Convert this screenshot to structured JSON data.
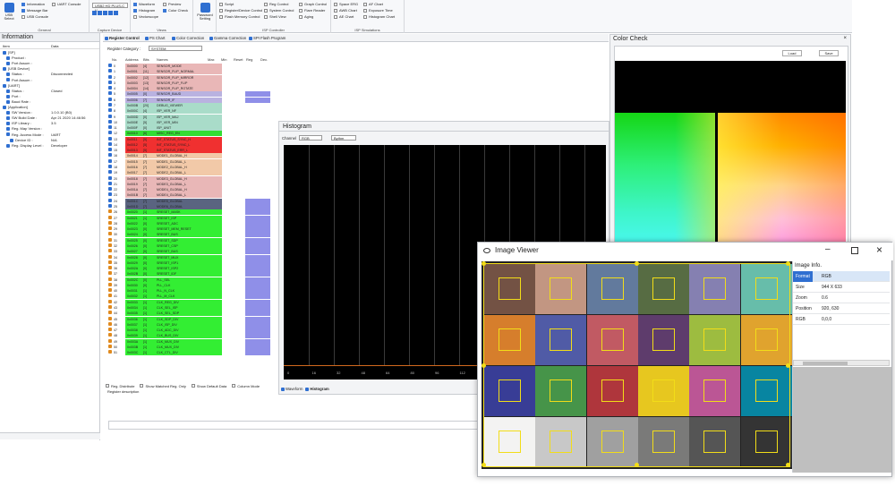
{
  "ribbon": {
    "usb_select_label": "USB Select",
    "general_checks": [
      "Information",
      "Message Bar",
      "USB Console"
    ],
    "general_checks2": [
      "UART Console"
    ],
    "general_caption": "General",
    "capture_combo": "USB2 HD PLUS-C V...",
    "capture_caption": "Capture Device",
    "view_checks": [
      "Waveform",
      "Histogram",
      "Vectorscope"
    ],
    "view_checks2": [
      "Preview",
      "Color Check"
    ],
    "view_caption": "Views",
    "password_label": "Password Setting",
    "isp_checks": [
      "Script",
      "Register/Device Control",
      "Flash Memory Control"
    ],
    "isp_checks2": [
      "Reg Control",
      "System Control",
      "Shell View"
    ],
    "isp_checks3": [
      "Graph Control",
      "Flare Reader",
      "Aging"
    ],
    "isp_caption": "ISP Controller",
    "spec_checks": [
      "Space ERG",
      "AWB Chart",
      "AE Chart"
    ],
    "spec_checks2": [
      "AF Chart",
      "Exposure Time",
      "Histogram Chart"
    ],
    "spec_caption": "ISP Simulations"
  },
  "info_panel": {
    "title": "Information",
    "col_item": "Item",
    "col_data": "Data",
    "rows": [
      {
        "k": "[SP]",
        "v": "",
        "lvl": 0,
        "icon": true
      },
      {
        "k": "Product :",
        "v": "",
        "lvl": 1,
        "icon": true
      },
      {
        "k": "Port Assum :",
        "v": "",
        "lvl": 1,
        "icon": true
      },
      {
        "k": "[USB Device]",
        "v": "",
        "lvl": 0,
        "icon": true
      },
      {
        "k": "Status :",
        "v": "Disconnected",
        "lvl": 1,
        "icon": true
      },
      {
        "k": "Port Assum :",
        "v": "",
        "lvl": 1,
        "icon": true
      },
      {
        "k": "[UART]",
        "v": "",
        "lvl": 0,
        "icon": true
      },
      {
        "k": "Status :",
        "v": "Closed",
        "lvl": 1,
        "icon": true
      },
      {
        "k": "Port :",
        "v": "",
        "lvl": 1,
        "icon": true
      },
      {
        "k": "Baud Rate :",
        "v": "",
        "lvl": 1,
        "icon": true
      },
      {
        "k": "[Application]",
        "v": "",
        "lvl": 0,
        "icon": true
      },
      {
        "k": "SW Version :",
        "v": "1.0.0.10 (B0)",
        "lvl": 1,
        "icon": true
      },
      {
        "k": "SW Build Date :",
        "v": "Apr 21 2020 14:46:56",
        "lvl": 1,
        "icon": true
      },
      {
        "k": "ISP Library :",
        "v": "3.5",
        "lvl": 1,
        "icon": true
      },
      {
        "k": "Reg. Map Version :",
        "v": "",
        "lvl": 1,
        "icon": true
      },
      {
        "k": "Reg. Access Mode :",
        "v": "UART",
        "lvl": 1,
        "icon": true
      },
      {
        "k": "Device ID :",
        "v": "N/A",
        "lvl": 2,
        "icon": true
      },
      {
        "k": "Reg. Display Level :",
        "v": "Developer",
        "lvl": 1,
        "icon": true
      }
    ]
  },
  "tabs": [
    "Register Control",
    "PS Chart",
    "Color Correction",
    "Gamma Correction",
    "SPI Flash Program"
  ],
  "register": {
    "category_label": "Register Category :",
    "category_value": "SYSTEM",
    "headers": [
      "No.",
      "Address",
      "Bits",
      "Names",
      "Max",
      "Min",
      "Reset",
      "Reg",
      "Dec."
    ],
    "rows": [
      {
        "no": "0",
        "addr": "0x0000",
        "bits": "[4]",
        "name": "SENSOR_MODE",
        "c": "#e9b7b7"
      },
      {
        "no": "1",
        "addr": "0x0001",
        "bits": "[11]",
        "name": "SENSOR_FLIP_NORMAL",
        "c": "#e9b7b7"
      },
      {
        "no": "2",
        "addr": "0x0002",
        "bits": "[12]",
        "name": "SENSOR_FLIP_MIRROR",
        "c": "#e9b7b7"
      },
      {
        "no": "3",
        "addr": "0x0003",
        "bits": "[13]",
        "name": "SENSOR_FLIP_FLIP",
        "c": "#e9b7b7"
      },
      {
        "no": "4",
        "addr": "0x0004",
        "bits": "[14]",
        "name": "SENSOR_FLIP_ROTATE",
        "c": "#e9b7b7"
      },
      {
        "no": "5",
        "addr": "0x0005",
        "bits": "[0]",
        "name": "SENSOR_BAUD",
        "c": "#b9b2e0"
      },
      {
        "no": "6",
        "addr": "0x0006",
        "bits": "[7]",
        "name": "SENSOR_IF",
        "c": "#b9b2e0"
      },
      {
        "no": "7",
        "addr": "0x000B",
        "bits": "[20]",
        "name": "DEBUG_VIEWER",
        "c": "#a9dcc9"
      },
      {
        "no": "8",
        "addr": "0x000C",
        "bits": "[4]",
        "name": "ISP_VER_NF",
        "c": "#a9dcc9"
      },
      {
        "no": "9",
        "addr": "0x000D",
        "bits": "[0]",
        "name": "ISP_VER_MAJ",
        "c": "#a9dcc9"
      },
      {
        "no": "10",
        "addr": "0x000E",
        "bits": "[5]",
        "name": "ISP_VER_MIN",
        "c": "#a9dcc9"
      },
      {
        "no": "11",
        "addr": "0x000F",
        "bits": "[0]",
        "name": "ISP_UNIT",
        "c": "#a9dcc9"
      },
      {
        "no": "12",
        "addr": "0x0010",
        "bits": "[6]",
        "name": "MISC_REG_EN",
        "c": "#33dd33"
      },
      {
        "no": "13",
        "addr": "0x0011",
        "bits": "[5]",
        "name": "INT_STATUS_SYNC_H",
        "c": "#f03030"
      },
      {
        "no": "14",
        "addr": "0x0012",
        "bits": "[5]",
        "name": "INT_STATUS_SYNC_L",
        "c": "#f03030"
      },
      {
        "no": "15",
        "addr": "0x0013",
        "bits": "[5]",
        "name": "INT_STATUS_ERR_L",
        "c": "#f03030"
      },
      {
        "no": "16",
        "addr": "0x0014",
        "bits": "[7]",
        "name": "MODE1_GLOBAL_H",
        "c": "#f2c9a8"
      },
      {
        "no": "17",
        "addr": "0x0015",
        "bits": "[7]",
        "name": "MODE1_GLOBAL_L",
        "c": "#f2c9a8"
      },
      {
        "no": "18",
        "addr": "0x0016",
        "bits": "[7]",
        "name": "MODE2_GLOBAL_H",
        "c": "#f2c9a8"
      },
      {
        "no": "19",
        "addr": "0x0017",
        "bits": "[7]",
        "name": "MODE2_GLOBAL_L",
        "c": "#f2c9a8"
      },
      {
        "no": "20",
        "addr": "0x0018",
        "bits": "[7]",
        "name": "MODE3_GLOBAL_H",
        "c": "#e9b7b7"
      },
      {
        "no": "21",
        "addr": "0x0019",
        "bits": "[7]",
        "name": "MODE3_GLOBAL_L",
        "c": "#e9b7b7"
      },
      {
        "no": "22",
        "addr": "0x001A",
        "bits": "[7]",
        "name": "MODE4_GLOBAL_H",
        "c": "#e9b7b7"
      },
      {
        "no": "23",
        "addr": "0x001B",
        "bits": "[7]",
        "name": "MODE4_GLOBAL_L",
        "c": "#e9b7b7"
      },
      {
        "no": "24",
        "addr": "0x001C",
        "bits": "[7]",
        "name": "MODE5_GLOBAL",
        "c": "#5a6480"
      },
      {
        "no": "25",
        "addr": "0x001D",
        "bits": "[7]",
        "name": "MODE6_GLOBAL",
        "c": "#5a6480"
      },
      {
        "no": "26",
        "addr": "0x0020",
        "bits": "[1]",
        "name": "SRESET_MASK",
        "c": "#33ee33"
      },
      {
        "no": "27",
        "addr": "0x0021",
        "bits": "[1]",
        "name": "SRESET_ISP",
        "c": "#33ee33"
      },
      {
        "no": "28",
        "addr": "0x0022",
        "bits": "[0]",
        "name": "SRESET_ADC",
        "c": "#33ee33"
      },
      {
        "no": "29",
        "addr": "0x0023",
        "bits": "[0]",
        "name": "SRESET_MEM_RESET",
        "c": "#33ee33"
      },
      {
        "no": "30",
        "addr": "0x0024",
        "bits": "[0]",
        "name": "SRESET_BUS",
        "c": "#33ee33"
      },
      {
        "no": "31",
        "addr": "0x0025",
        "bits": "[0]",
        "name": "SRESET_SDP",
        "c": "#33ee33"
      },
      {
        "no": "32",
        "addr": "0x0026",
        "bits": "[0]",
        "name": "SRESET_CSP",
        "c": "#33ee33"
      },
      {
        "no": "33",
        "addr": "0x0027",
        "bits": "[0]",
        "name": "SRESET_BUS",
        "c": "#33ee33"
      },
      {
        "no": "34",
        "addr": "0x0028",
        "bits": "[0]",
        "name": "SRESET_MUX",
        "c": "#33ee33"
      },
      {
        "no": "35",
        "addr": "0x0029",
        "bits": "[0]",
        "name": "SRESET_ISP1",
        "c": "#33ee33"
      },
      {
        "no": "36",
        "addr": "0x002A",
        "bits": "[0]",
        "name": "SRESET_ISP2",
        "c": "#33ee33"
      },
      {
        "no": "37",
        "addr": "0x002B",
        "bits": "[0]",
        "name": "SRESET_IDF",
        "c": "#33ee33"
      },
      {
        "no": "38",
        "addr": "0x002C",
        "bits": "[0]",
        "name": "PLL_SEL",
        "c": "#33ee33"
      },
      {
        "no": "39",
        "addr": "0x0030",
        "bits": "[0]",
        "name": "PLL_CLK",
        "c": "#33ee33"
      },
      {
        "no": "40",
        "addr": "0x0031",
        "bits": "[1]",
        "name": "PLL_N_CLK",
        "c": "#33ee33"
      },
      {
        "no": "41",
        "addr": "0x0032",
        "bits": "[1]",
        "name": "PLL_M_CLK",
        "c": "#33ee33"
      },
      {
        "no": "42",
        "addr": "0x0033",
        "bits": "[1]",
        "name": "CLK_REG_DIV",
        "c": "#33ee33"
      },
      {
        "no": "43",
        "addr": "0x0034",
        "bits": "[1]",
        "name": "CLK_SEL_ISP",
        "c": "#33ee33"
      },
      {
        "no": "44",
        "addr": "0x0035",
        "bits": "[1]",
        "name": "CLK_SEL_SDP",
        "c": "#33ee33"
      },
      {
        "no": "45",
        "addr": "0x0036",
        "bits": "[1]",
        "name": "CLK_SDP_DIV",
        "c": "#33ee33"
      },
      {
        "no": "46",
        "addr": "0x0037",
        "bits": "[1]",
        "name": "CLK_ISP_DIV",
        "c": "#33ee33"
      },
      {
        "no": "47",
        "addr": "0x0038",
        "bits": "[1]",
        "name": "CLK_ADC_DIV",
        "c": "#33ee33"
      },
      {
        "no": "48",
        "addr": "0x0039",
        "bits": "[1]",
        "name": "CLK_BUS_DIV",
        "c": "#33ee33"
      },
      {
        "no": "49",
        "addr": "0x003A",
        "bits": "[1]",
        "name": "CLK_MUX_DIV",
        "c": "#33ee33"
      },
      {
        "no": "50",
        "addr": "0x003B",
        "bits": "[1]",
        "name": "CLK_MUX_DIV",
        "c": "#33ee33"
      },
      {
        "no": "51",
        "addr": "0x003C",
        "bits": "[1]",
        "name": "CLK_CTL_DIV",
        "c": "#33ee33"
      }
    ],
    "footer_checks": [
      "Reg. Distribute",
      "Show Matched Reg. Only",
      "Show Default Data",
      "Column Mode"
    ],
    "description_label": "Register description"
  },
  "histogram": {
    "title": "Histogram",
    "channel_label": "Channel",
    "channel_value": "RGB",
    "mode_value": "Bythm",
    "x_ticks": [
      "0",
      "16",
      "32",
      "48",
      "64",
      "80",
      "96",
      "112",
      "128",
      "144",
      "160"
    ],
    "bottom_tabs": [
      "Waveform",
      "Histogram"
    ]
  },
  "color_check": {
    "title": "Color Check",
    "load_label": "Load",
    "save_label": "Save"
  },
  "image_viewer": {
    "title": "Image Viewer",
    "info_title": "Image Info.",
    "info": [
      {
        "k": "Format",
        "v": "RGB"
      },
      {
        "k": "Size",
        "v": "944 X 633"
      },
      {
        "k": "Zoom",
        "v": "0.6"
      },
      {
        "k": "Position",
        "v": "920, 630"
      },
      {
        "k": "RGB",
        "v": "0,0,0"
      }
    ],
    "patches": [
      "#735244",
      "#c29682",
      "#627a9d",
      "#576c43",
      "#8580b1",
      "#67bdaa",
      "#d67e2c",
      "#505ba6",
      "#c15a63",
      "#5e3c6c",
      "#9dbc40",
      "#e0a32e",
      "#383d96",
      "#469449",
      "#af363c",
      "#e7c71f",
      "#bb5695",
      "#0885a1",
      "#f3f3f2",
      "#c8c8c8",
      "#a0a0a0",
      "#7a7a79",
      "#555555",
      "#343434"
    ]
  }
}
